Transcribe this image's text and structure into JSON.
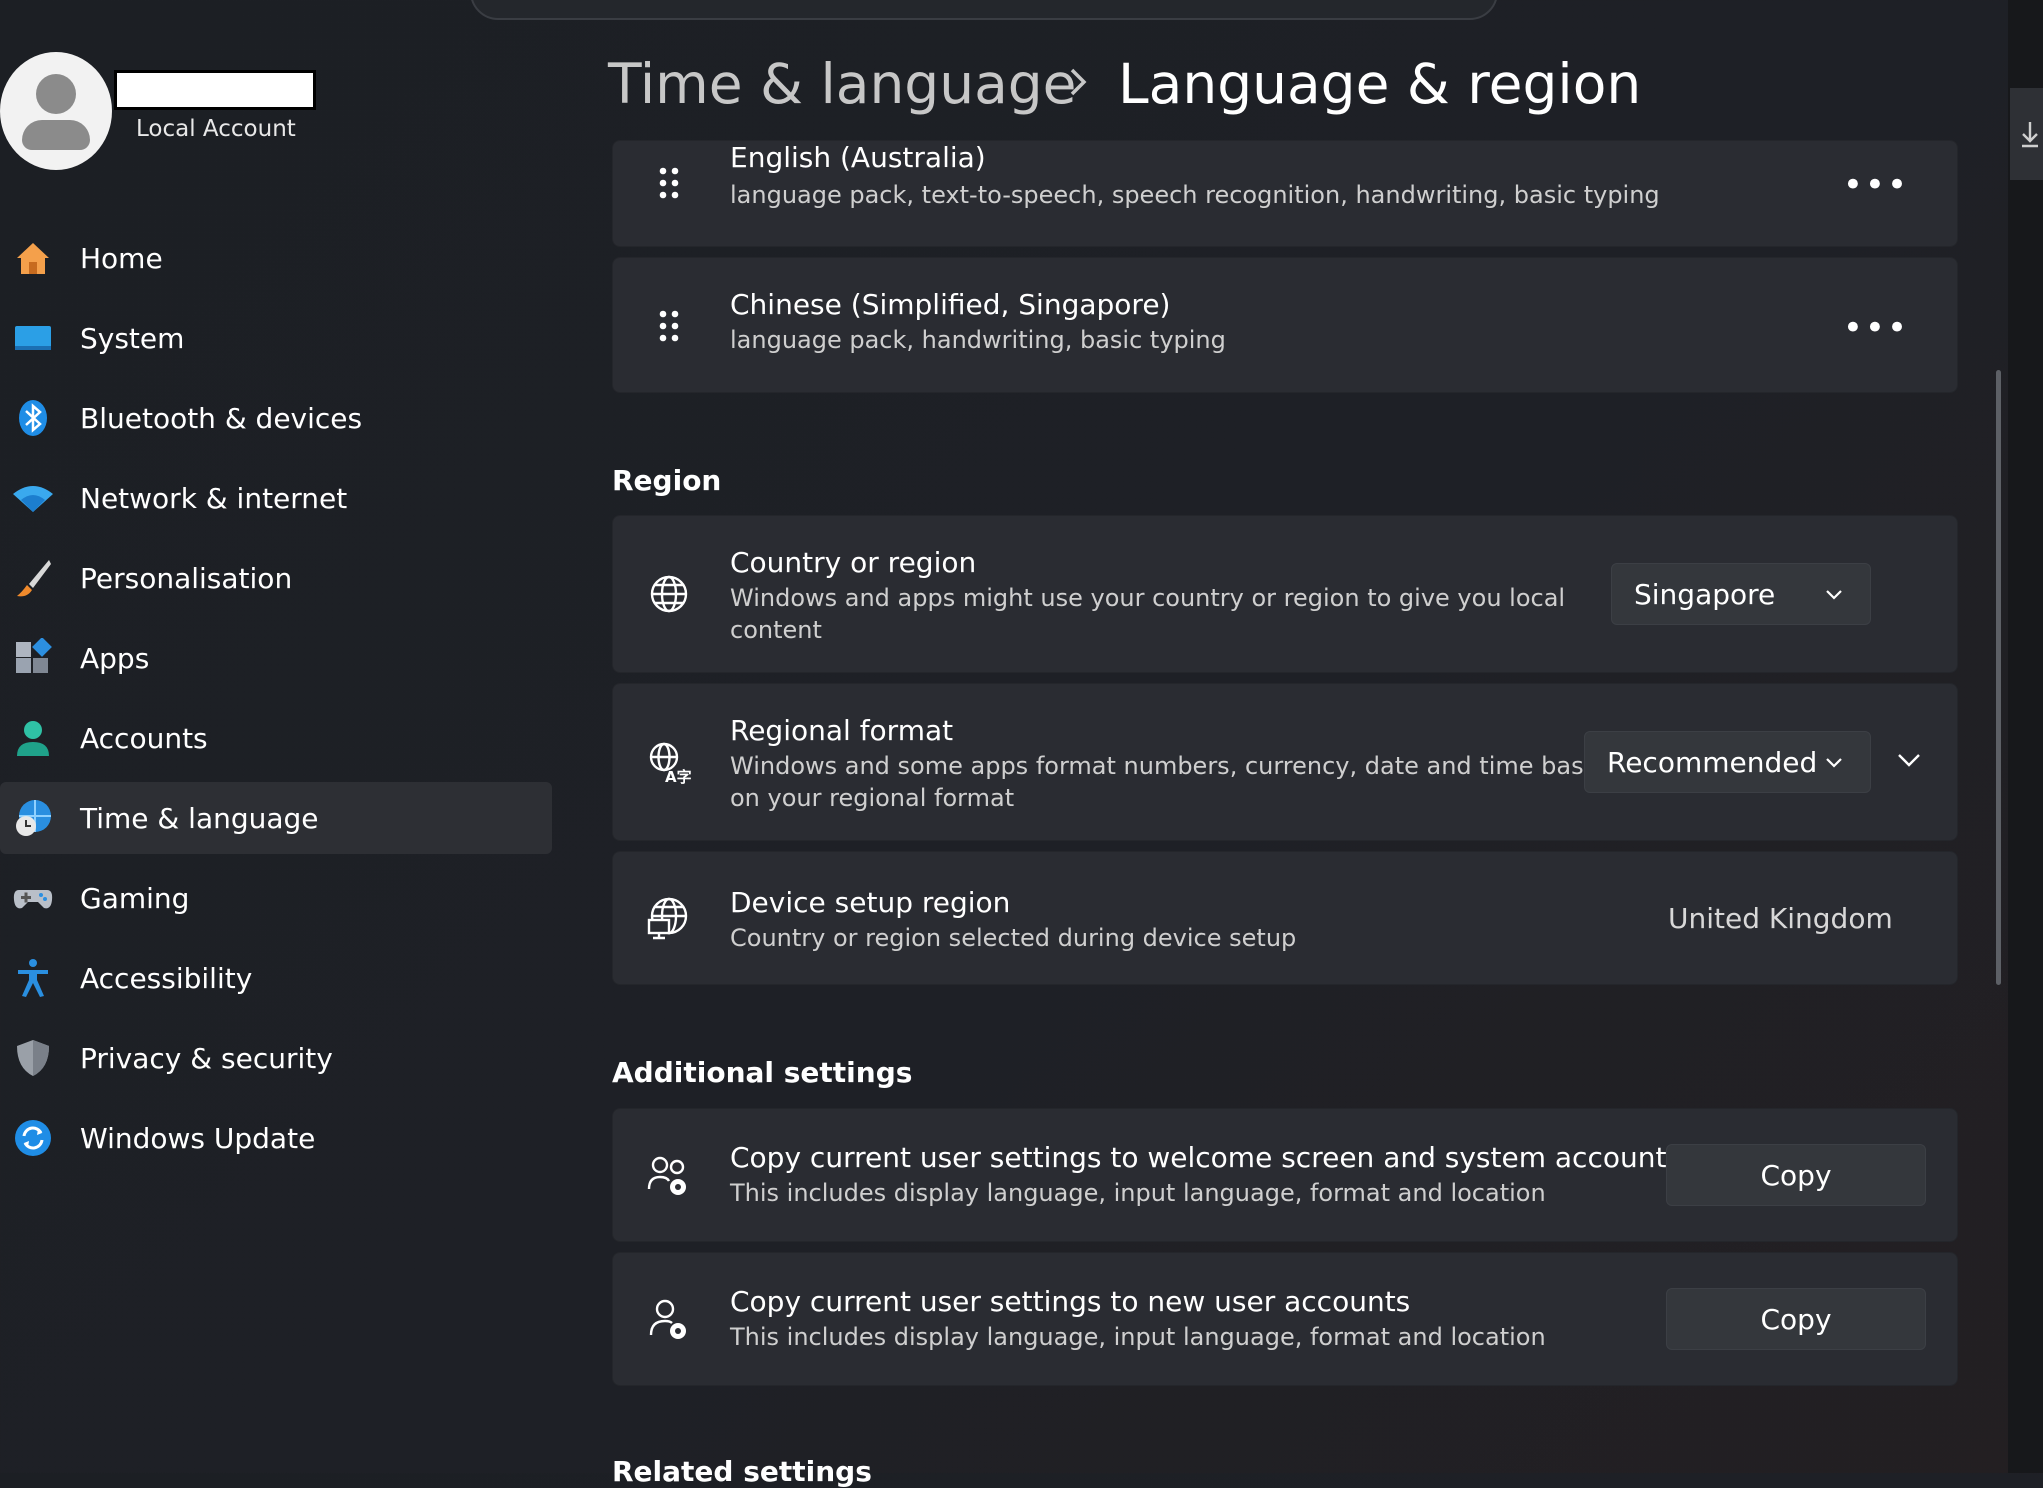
{
  "profile": {
    "account_type": "Local Account"
  },
  "sidebar": {
    "items": [
      {
        "label": "Home",
        "icon": "home-icon"
      },
      {
        "label": "System",
        "icon": "system-icon"
      },
      {
        "label": "Bluetooth & devices",
        "icon": "bluetooth-icon"
      },
      {
        "label": "Network & internet",
        "icon": "wifi-icon"
      },
      {
        "label": "Personalisation",
        "icon": "brush-icon"
      },
      {
        "label": "Apps",
        "icon": "apps-icon"
      },
      {
        "label": "Accounts",
        "icon": "person-icon"
      },
      {
        "label": "Time & language",
        "icon": "globe-clock-icon",
        "active": true
      },
      {
        "label": "Gaming",
        "icon": "gamepad-icon"
      },
      {
        "label": "Accessibility",
        "icon": "accessibility-icon"
      },
      {
        "label": "Privacy & security",
        "icon": "shield-icon"
      },
      {
        "label": "Windows Update",
        "icon": "update-icon"
      }
    ]
  },
  "header": {
    "parent": "Time & language",
    "current": "Language & region"
  },
  "languages": [
    {
      "name": "English (Australia)",
      "features": "language pack, text-to-speech, speech recognition, handwriting, basic typing"
    },
    {
      "name": "Chinese (Simplified, Singapore)",
      "features": "language pack, handwriting, basic typing"
    }
  ],
  "region": {
    "section_title": "Region",
    "country": {
      "title": "Country or region",
      "desc_line1": "Windows and apps might use your country or region to give you local",
      "desc_line2": "content",
      "value": "Singapore"
    },
    "format": {
      "title": "Regional format",
      "desc_line1": "Windows and some apps format numbers, currency, date and time based",
      "desc_line2": "on your regional format",
      "value": "Recommended"
    },
    "device_setup": {
      "title": "Device setup region",
      "desc": "Country or region selected during device setup",
      "value": "United Kingdom"
    }
  },
  "additional": {
    "section_title": "Additional settings",
    "welcome": {
      "title": "Copy current user settings to welcome screen and system accounts",
      "desc": "This includes display language, input language, format and location",
      "button": "Copy"
    },
    "new_users": {
      "title": "Copy current user settings to new user accounts",
      "desc": "This includes display language, input language, format and location",
      "button": "Copy"
    }
  },
  "related": {
    "section_title": "Related settings"
  },
  "more_label": "•••"
}
